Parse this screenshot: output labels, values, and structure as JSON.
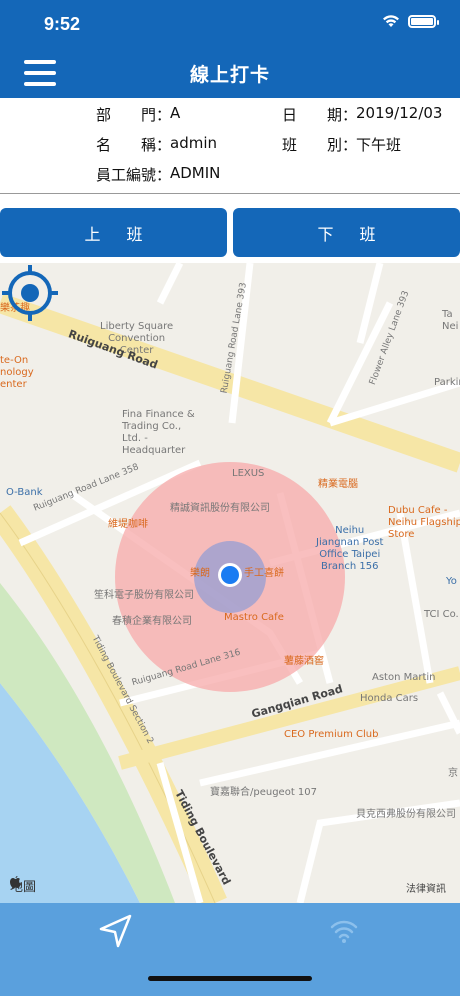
{
  "status_bar": {
    "time": "9:52"
  },
  "nav": {
    "title": "線上打卡"
  },
  "info": {
    "department_label": "部　　門：",
    "department_value": "A",
    "name_label": "名　　稱：",
    "name_value": "admin",
    "employee_id_label": "員工編號：",
    "employee_id_value": "ADMIN",
    "date_label": "日　　期：",
    "date_value": "2019/12/03",
    "shift_label": "班　　別：",
    "shift_value": "下午班"
  },
  "buttons": {
    "clock_in": "上班",
    "clock_out": "下班"
  },
  "map": {
    "brand": "地圖",
    "legal": "法律資訊",
    "roads": {
      "ruiguang": "Ruiguang Road",
      "lane393": "Ruiguang Road Lane 393",
      "lane358": "Ruiguang Road Lane 358",
      "lane316": "Ruiguang Road Lane 316",
      "gangqian": "Gangqian Road",
      "tiding_section": "Tiding Boulevard Section 2",
      "tiding": "Tiding Boulevard",
      "flower": "Flower Alley Lane 393"
    },
    "pois": {
      "tea": "樂茶趣",
      "te_on": "te-On",
      "nology": "nology",
      "enter": "enter",
      "liberty": "Liberty Square\nConvention\nCenter",
      "fina": "Fina Finance &\nTrading Co.,\nLtd. -\nHeadquarter",
      "lexus": "LEXUS",
      "jingye": "精業電腦",
      "obank": "O-Bank",
      "weiti": "維堤咖啡",
      "jingcheng": "精誠資訊股份有限公司",
      "dubu": "Dubu Cafe -\nNeihu Flagship\nStore",
      "neihu_post": "Neihu\nJiangnan Post\nOffice Taipei\nBranch 156",
      "lelang": "樂朗",
      "handmade": "手工喜餅",
      "liqi": "笙科電子股份有限公司",
      "chunji": "春積企業有限公司",
      "mastro": "Mastro Cafe",
      "shuteng": "薯藤酒窖",
      "aston": "Aston Martin",
      "honda": "Honda Cars",
      "ceo": "CEO Premium Club",
      "baojia": "寶嘉聯合/peugeot 107",
      "beike": "貝克西弗股份有限公司",
      "tci": "TCI Co.",
      "jing": "京",
      "you": "Yo",
      "tai": "Ta",
      "nei": "Nei",
      "parkin": "Parkin"
    }
  },
  "colors": {
    "primary": "#1467b8",
    "bottom_bar": "#5aa0dd",
    "location_dot": "#1a7cf2",
    "radius_fill": "#f7a9a9"
  }
}
